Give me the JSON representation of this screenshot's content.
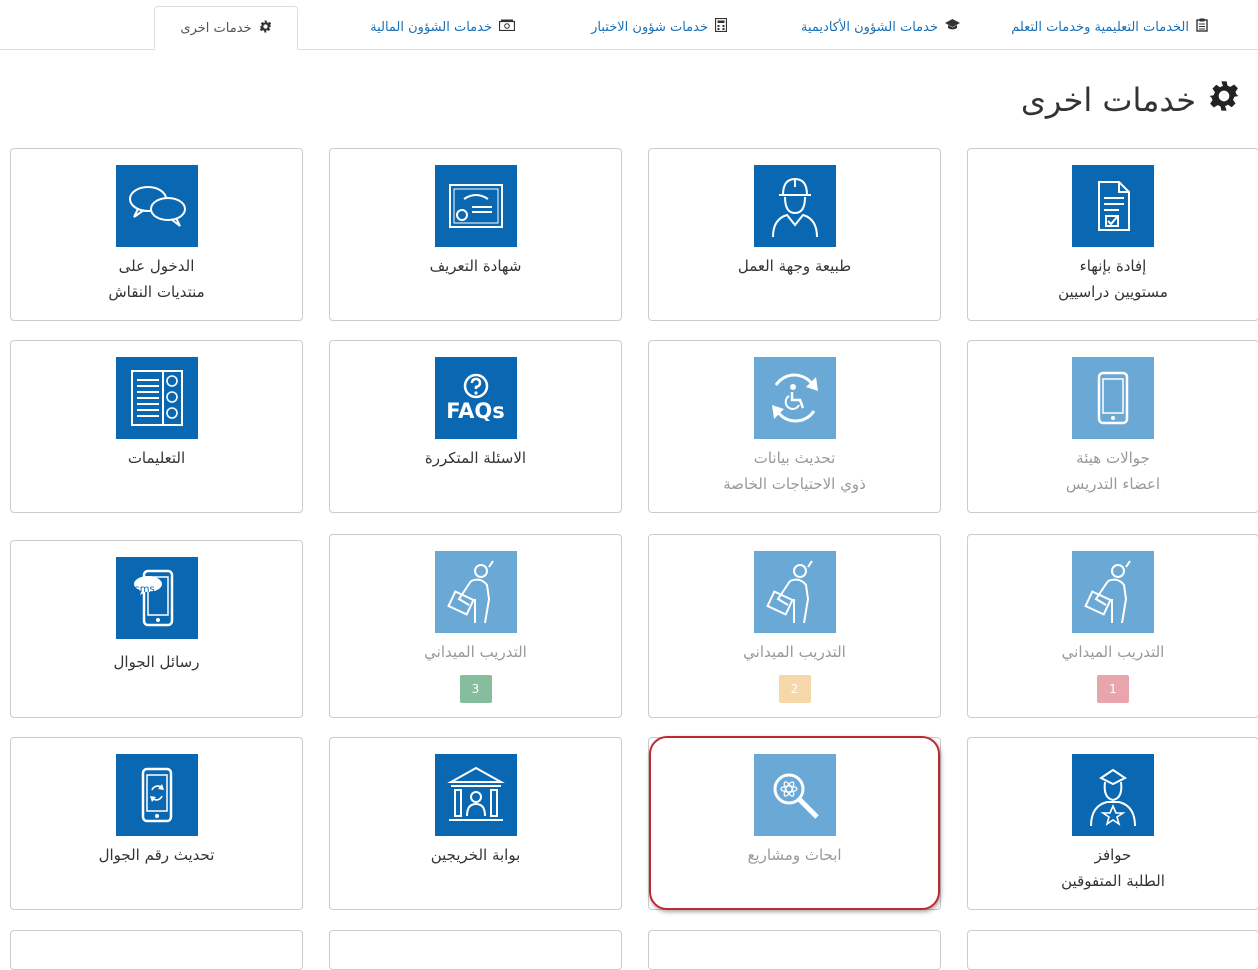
{
  "tabs": [
    {
      "label": "الخدمات التعليمية وخدمات التعلم",
      "icon": "clipboard-icon"
    },
    {
      "label": "خدمات الشؤون الأكاديمية",
      "icon": "graduation-cap-icon"
    },
    {
      "label": "خدمات شؤون الاختبار",
      "icon": "calculator-icon"
    },
    {
      "label": "خدمات الشؤون المالية",
      "icon": "money-icon"
    },
    {
      "label": "خدمات اخرى",
      "icon": "gear-icon",
      "active": true
    }
  ],
  "page": {
    "title": "خدمات اخرى"
  },
  "tiles": [
    {
      "line1": "إفادة بإنهاء",
      "line2": "مستويين دراسيين",
      "icon": "document-check-icon"
    },
    {
      "line1": "طبيعة وجهة العمل",
      "line2": "",
      "icon": "worker-icon"
    },
    {
      "line1": "شهادة التعريف",
      "line2": "",
      "icon": "certificate-icon"
    },
    {
      "line1": "الدخول على",
      "line2": "منتديات النقاش",
      "icon": "chat-bubbles-icon"
    },
    {
      "line1": "جوالات هيئة",
      "line2": "اعضاء التدريس",
      "icon": "mobile-phone-icon",
      "dim": true
    },
    {
      "line1": "تحديث بيانات",
      "line2": "ذوي الاحتياجات الخاصة",
      "icon": "accessibility-refresh-icon",
      "dim": true
    },
    {
      "line1": "الاسئلة المتكررة",
      "line2": "",
      "icon": "faq-icon",
      "faq_text": "FAQs"
    },
    {
      "line1": "التعليمات",
      "line2": "",
      "icon": "instructions-list-icon"
    },
    {
      "line1": "التدريب الميداني",
      "badge": "1",
      "badge_color": "#e8a6ac",
      "icon": "field-training-icon",
      "dim": true
    },
    {
      "line1": "التدريب الميداني",
      "badge": "2",
      "badge_color": "#f5d7a9",
      "icon": "field-training-icon",
      "dim": true
    },
    {
      "line1": "التدريب الميداني",
      "badge": "3",
      "badge_color": "#86bd9d",
      "icon": "field-training-icon",
      "dim": true
    },
    {
      "line1": "رسائل الجوال",
      "line2": "",
      "icon": "sms-icon",
      "sms_text": "sms"
    },
    {
      "line1": "حوافز",
      "line2": "الطلبة المتفوقين",
      "icon": "star-student-icon"
    },
    {
      "line1": "ابحاث ومشاريع",
      "line2": "",
      "icon": "research-icon",
      "dim": true
    },
    {
      "line1": "بوابة الخريجين",
      "line2": "",
      "icon": "graduates-portal-icon"
    },
    {
      "line1": "تحديث رقم الجوال",
      "line2": "",
      "icon": "phone-update-icon"
    }
  ],
  "colors": {
    "accent": "#0a68b3",
    "accent_dim": "#6aa8d6",
    "highlight": "#c0282d",
    "link": "#1b6fb5"
  }
}
